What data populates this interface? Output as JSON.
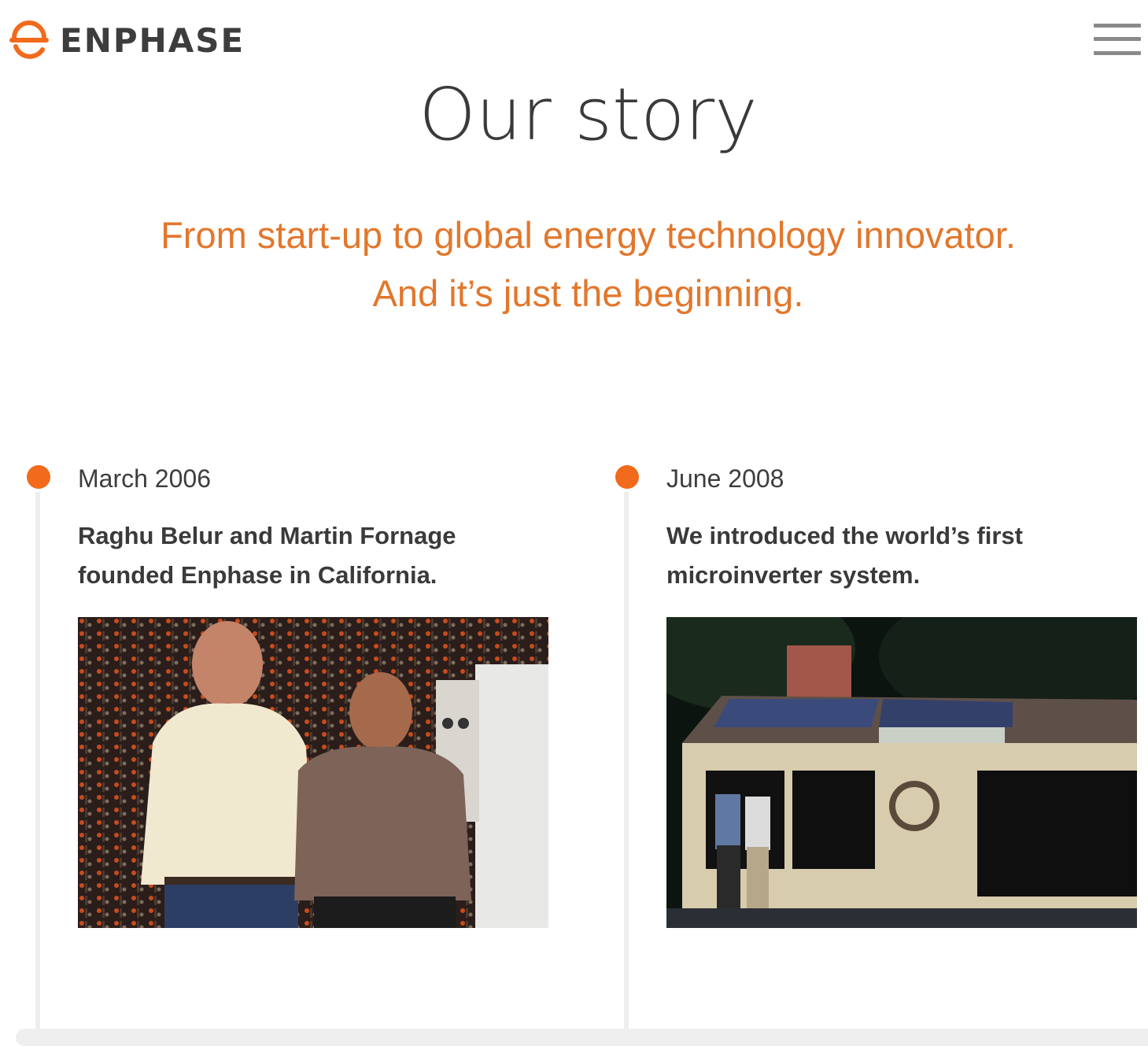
{
  "header": {
    "brand": "ENPHASE",
    "logo_icon": "enphase-logo-icon",
    "menu_icon": "hamburger-menu-icon",
    "brand_color": "#f26a1b"
  },
  "page": {
    "title": "Our story",
    "subtitle_line1": "From start-up to global energy technology innovator.",
    "subtitle_line2": "And it’s just the beginning.",
    "subtitle_color": "#e2772c"
  },
  "timeline": {
    "dot_color": "#f26a1b",
    "items": [
      {
        "date": "March 2006",
        "text_line1": "Raghu Belur and Martin Fornage",
        "text_line2": "founded Enphase in California.",
        "image": "founders-photo"
      },
      {
        "date": "June 2008",
        "text_line1": "We introduced the world’s first",
        "text_line2": "microinverter system.",
        "image": "house-solar-photo"
      }
    ]
  }
}
